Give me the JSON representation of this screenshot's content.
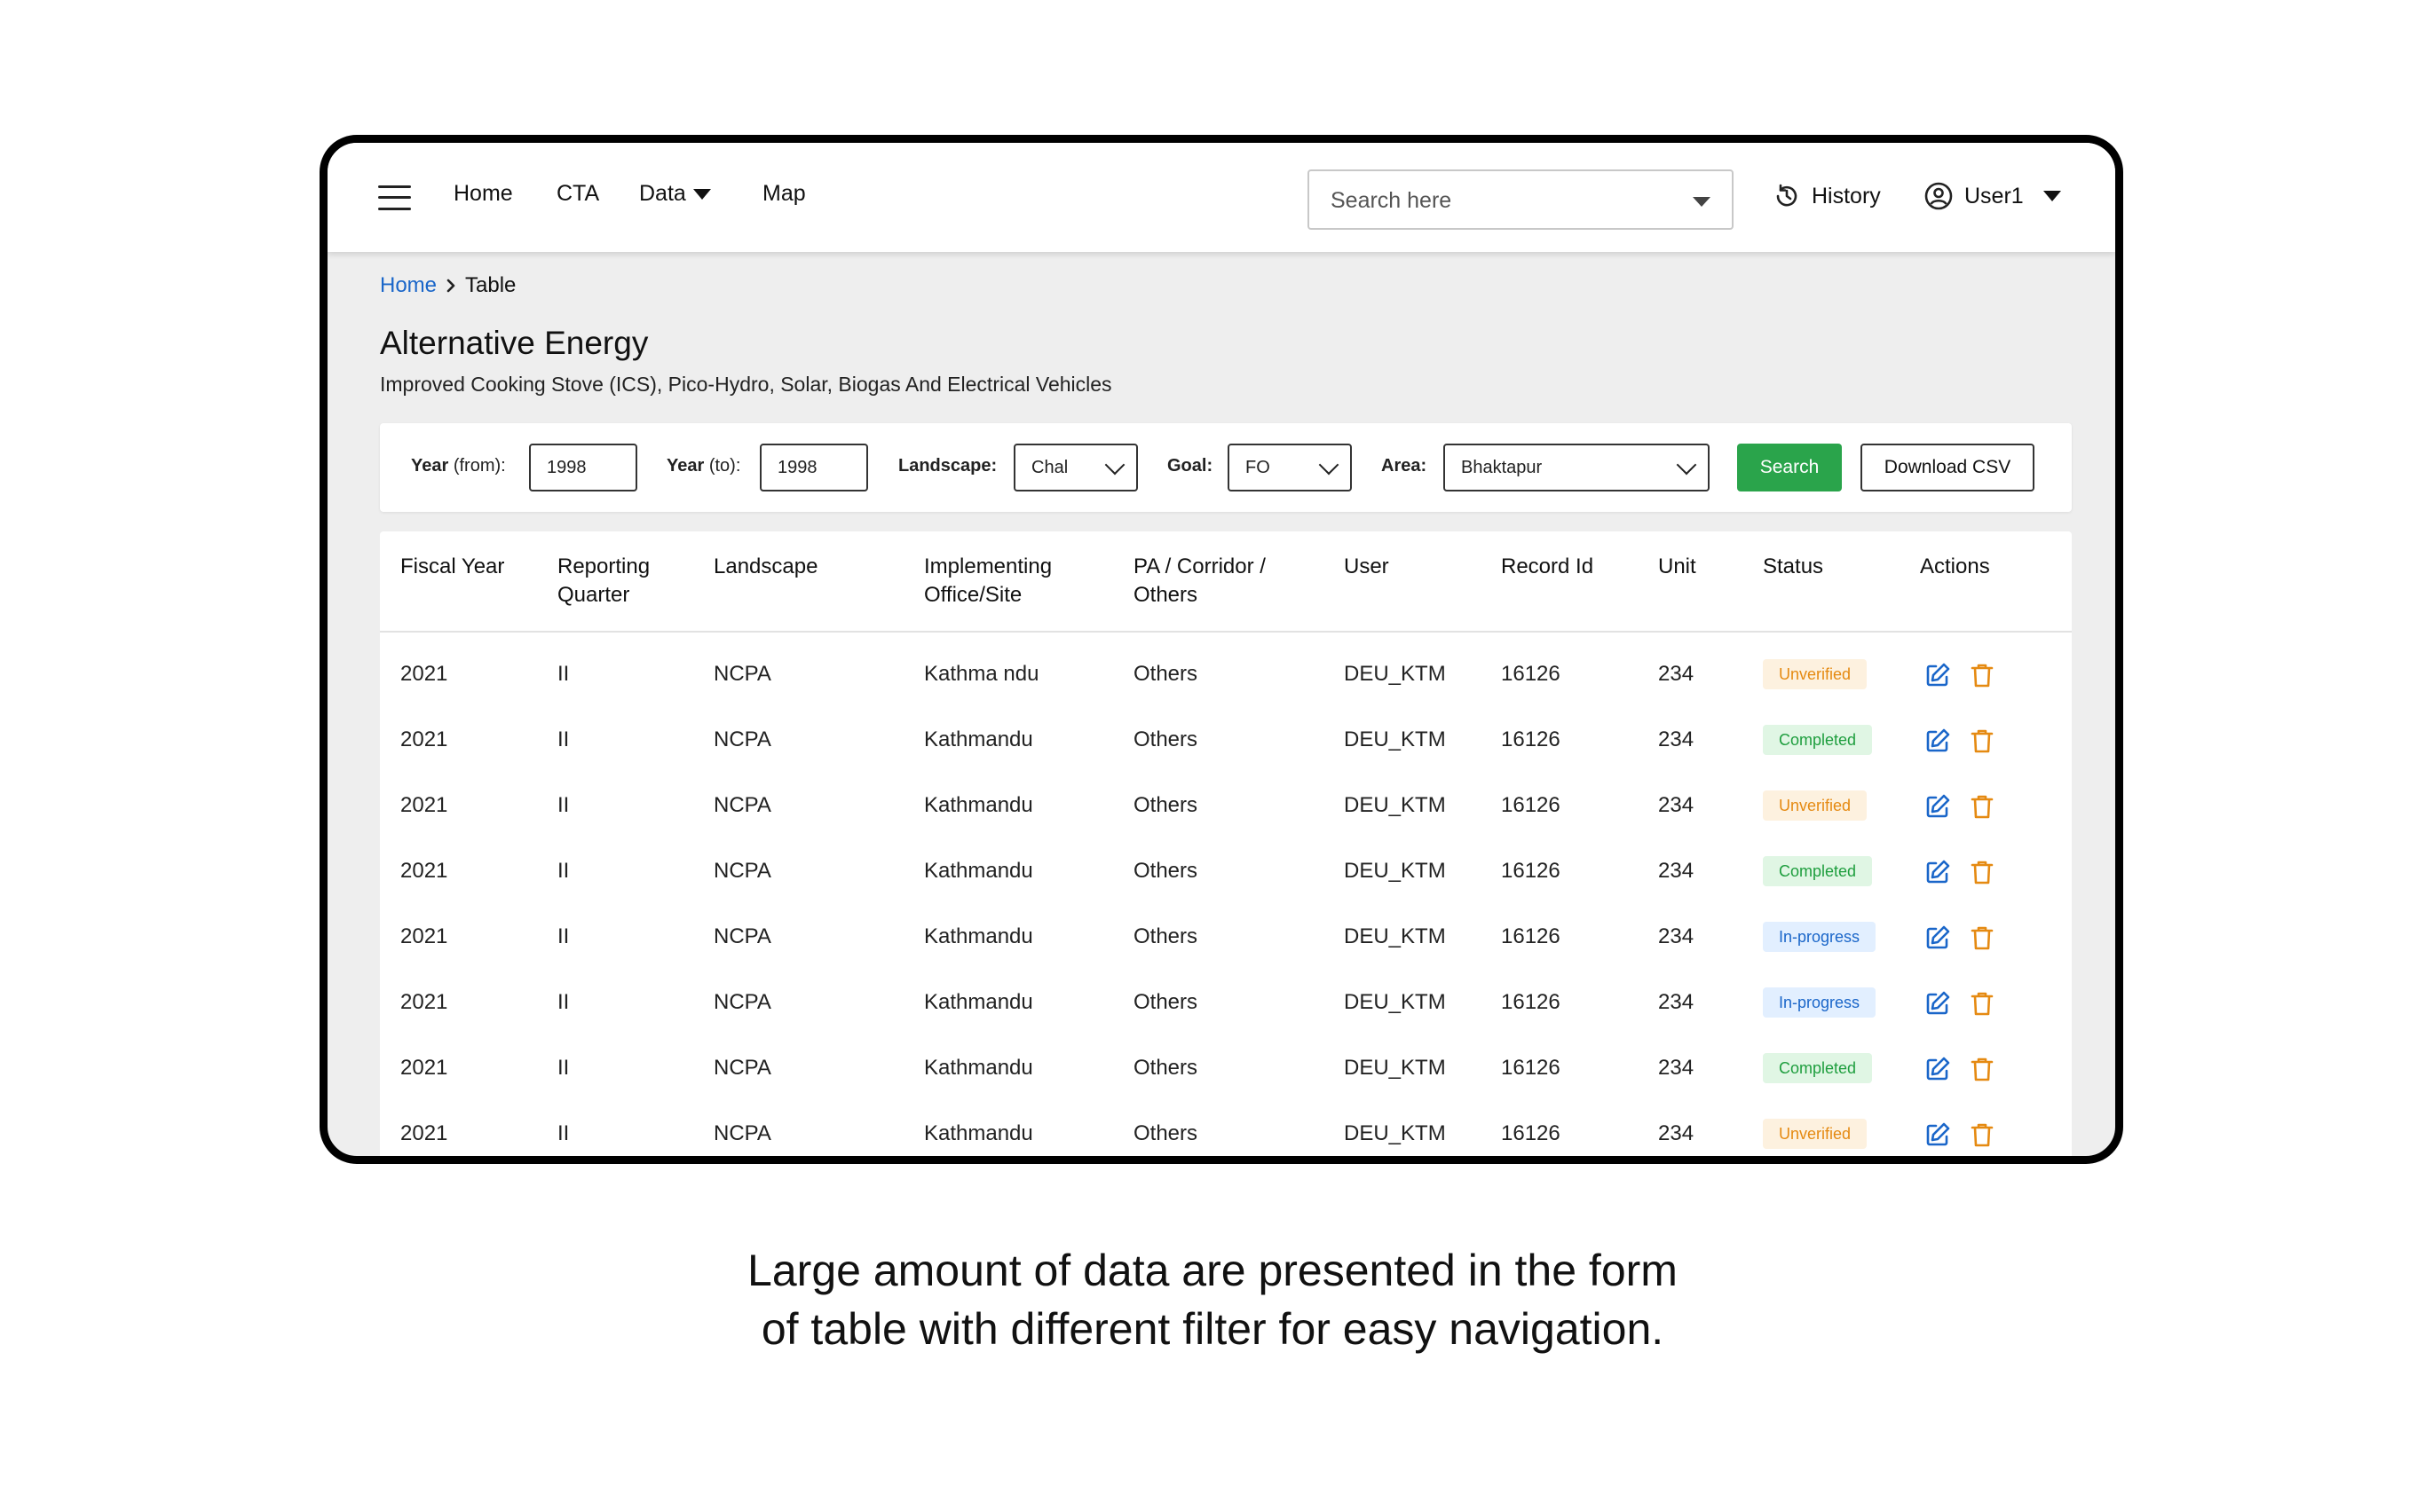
{
  "nav": {
    "home": "Home",
    "cta": "CTA",
    "data": "Data",
    "map": "Map",
    "search_placeholder": "Search here",
    "history": "History",
    "user": "User1"
  },
  "breadcrumb": {
    "home": "Home",
    "current": "Table"
  },
  "page": {
    "title": "Alternative Energy",
    "subtitle": "Improved Cooking Stove (ICS), Pico-Hydro, Solar, Biogas And Electrical Vehicles"
  },
  "filters": {
    "year_from_label": "Year",
    "year_from_suffix": "(from):",
    "year_from_value": "1998",
    "year_to_label": "Year",
    "year_to_suffix": "(to):",
    "year_to_value": "1998",
    "landscape_label": "Landscape:",
    "landscape_value": "Chal",
    "goal_label": "Goal:",
    "goal_value": "FO",
    "area_label": "Area:",
    "area_value": "Bhaktapur",
    "search_button": "Search",
    "download_button": "Download CSV"
  },
  "table": {
    "columns": [
      [
        "Fiscal Year"
      ],
      [
        "Reporting",
        "Quarter"
      ],
      [
        "Landscape"
      ],
      [
        "Implementing",
        "Office/Site"
      ],
      [
        "PA / Corridor /",
        "Others"
      ],
      [
        "User"
      ],
      [
        "Record Id"
      ],
      [
        "Unit"
      ],
      [
        "Status"
      ],
      [
        "Actions"
      ]
    ],
    "rows": [
      {
        "year": "2021",
        "quarter": "II",
        "landscape": "NCPA",
        "office": "Kathma ndu",
        "pa": "Others",
        "user": "DEU_KTM",
        "record": "16126",
        "unit": "234",
        "status": "Unverified"
      },
      {
        "year": "2021",
        "quarter": "II",
        "landscape": "NCPA",
        "office": "Kathmandu",
        "pa": "Others",
        "user": "DEU_KTM",
        "record": "16126",
        "unit": "234",
        "status": "Completed"
      },
      {
        "year": "2021",
        "quarter": "II",
        "landscape": "NCPA",
        "office": "Kathmandu",
        "pa": "Others",
        "user": "DEU_KTM",
        "record": "16126",
        "unit": "234",
        "status": "Unverified"
      },
      {
        "year": "2021",
        "quarter": "II",
        "landscape": "NCPA",
        "office": "Kathmandu",
        "pa": "Others",
        "user": "DEU_KTM",
        "record": "16126",
        "unit": "234",
        "status": "Completed"
      },
      {
        "year": "2021",
        "quarter": "II",
        "landscape": "NCPA",
        "office": "Kathmandu",
        "pa": "Others",
        "user": "DEU_KTM",
        "record": "16126",
        "unit": "234",
        "status": "In-progress"
      },
      {
        "year": "2021",
        "quarter": "II",
        "landscape": "NCPA",
        "office": "Kathmandu",
        "pa": "Others",
        "user": "DEU_KTM",
        "record": "16126",
        "unit": "234",
        "status": "In-progress"
      },
      {
        "year": "2021",
        "quarter": "II",
        "landscape": "NCPA",
        "office": "Kathmandu",
        "pa": "Others",
        "user": "DEU_KTM",
        "record": "16126",
        "unit": "234",
        "status": "Completed"
      },
      {
        "year": "2021",
        "quarter": "II",
        "landscape": "NCPA",
        "office": "Kathmandu",
        "pa": "Others",
        "user": "DEU_KTM",
        "record": "16126",
        "unit": "234",
        "status": "Unverified"
      }
    ]
  },
  "icons": {
    "menu": "hamburger-icon",
    "history": "clock-icon",
    "user": "user-circle-icon",
    "edit": "edit-icon",
    "delete": "trash-icon"
  },
  "colors": {
    "edit_icon": "#1a66c9",
    "delete_icon": "#e58a12",
    "search_button": "#2aa44b",
    "link": "#1a66c9"
  },
  "caption": {
    "line1": "Large amount of data are presented in the form",
    "line2": "of table with different filter for easy navigation."
  }
}
